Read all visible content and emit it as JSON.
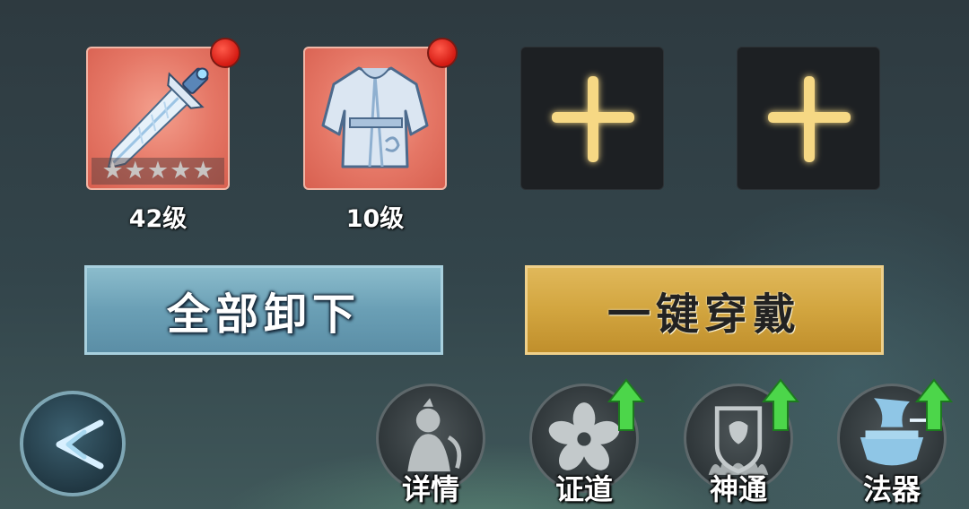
{
  "equipment_slots": [
    {
      "type": "weapon",
      "level_label": "42级",
      "stars": 5,
      "stars_filled": 0,
      "has_notification": true,
      "icon": "sword-icon"
    },
    {
      "type": "armor",
      "level_label": "10级",
      "has_notification": true,
      "icon": "robe-icon"
    },
    {
      "type": "empty",
      "icon": "plus-icon"
    },
    {
      "type": "empty",
      "icon": "plus-icon"
    }
  ],
  "buttons": {
    "unequip_all": "全部卸下",
    "equip_all": "一键穿戴"
  },
  "nav": [
    {
      "label": "详情",
      "icon": "cultivator-icon",
      "has_upgrade": false
    },
    {
      "label": "证道",
      "icon": "flower-icon",
      "has_upgrade": true
    },
    {
      "label": "神通",
      "icon": "shield-flame-icon",
      "has_upgrade": true
    },
    {
      "label": "法器",
      "icon": "cauldron-icon",
      "has_upgrade": true
    }
  ],
  "colors": {
    "filled_slot": "#e57766",
    "notification": "#e0251a",
    "unequip_button": "#6a9fb5",
    "equip_button": "#d2a53f",
    "upgrade_arrow": "#4cd64a",
    "plus_glow": "#f4d27a"
  }
}
